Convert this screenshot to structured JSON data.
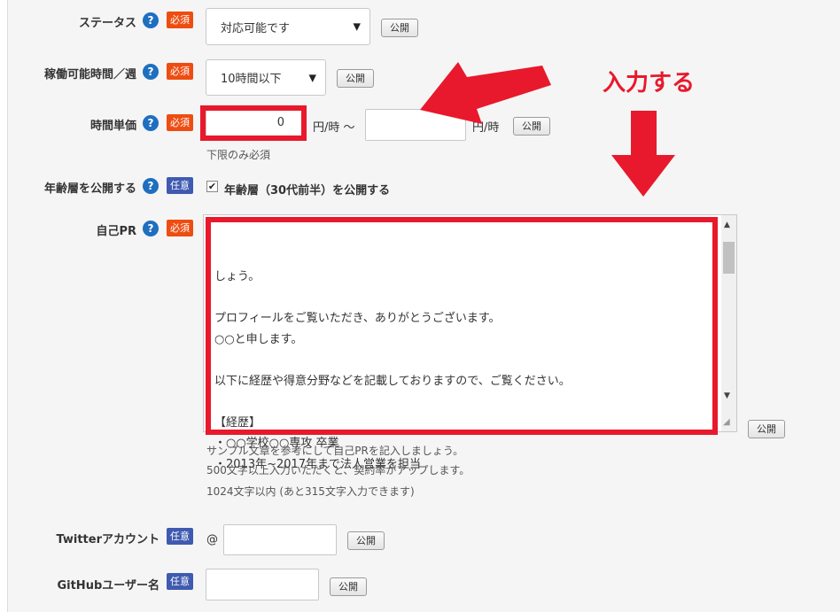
{
  "fields": {
    "status": {
      "label": "ステータス",
      "badge": "必須",
      "value": "対応可能です",
      "publish": "公開"
    },
    "hours": {
      "label": "稼働可能時間／週",
      "badge": "必須",
      "value": "10時間以下",
      "publish": "公開"
    },
    "rate": {
      "label": "時間単価",
      "badge": "必須",
      "min_value": "0",
      "unit1": "円/時 〜",
      "unit2": "円/時",
      "publish": "公開",
      "hint": "下限のみ必須"
    },
    "age": {
      "label": "年齢層を公開する",
      "badge": "任意",
      "checkbox_label": "年齢層（30代前半）を公開する",
      "checked": true
    },
    "pr": {
      "label": "自己PR",
      "badge": "必須",
      "publish": "公開",
      "lines": [
        "しょう。",
        "",
        "プロフィールをご覧いただき、ありがとうございます。",
        "○○と申します。",
        "",
        "以下に経歴や得意分野などを記載しておりますので、ご覧ください。",
        "",
        "【経歴】",
        "・○○学校○○専攻 卒業",
        "・2013年~2017年まで法人営業を担当"
      ],
      "hint1": "サンプル文章を参考にして自己PRを記入しましょう。",
      "hint2": "500文字以上入力いただくと、契約率がアップします。",
      "hint3": "1024文字以内 (あと315文字入力できます)"
    },
    "twitter": {
      "label": "Twitterアカウント",
      "badge": "任意",
      "prefix": "@",
      "publish": "公開"
    },
    "github": {
      "label": "GitHubユーザー名",
      "badge": "任意",
      "publish": "公開"
    }
  },
  "annotation": {
    "text": "入力する",
    "color": "#e8192c"
  },
  "icons": {
    "help": "question-circle-icon",
    "select_arrow": "caret-down-icon",
    "checkbox": "checkbox-checked-icon"
  },
  "colors": {
    "required": "#ee4d12",
    "optional": "#3f5ab0",
    "help": "#1e6fc0",
    "highlight": "#e8192c"
  }
}
